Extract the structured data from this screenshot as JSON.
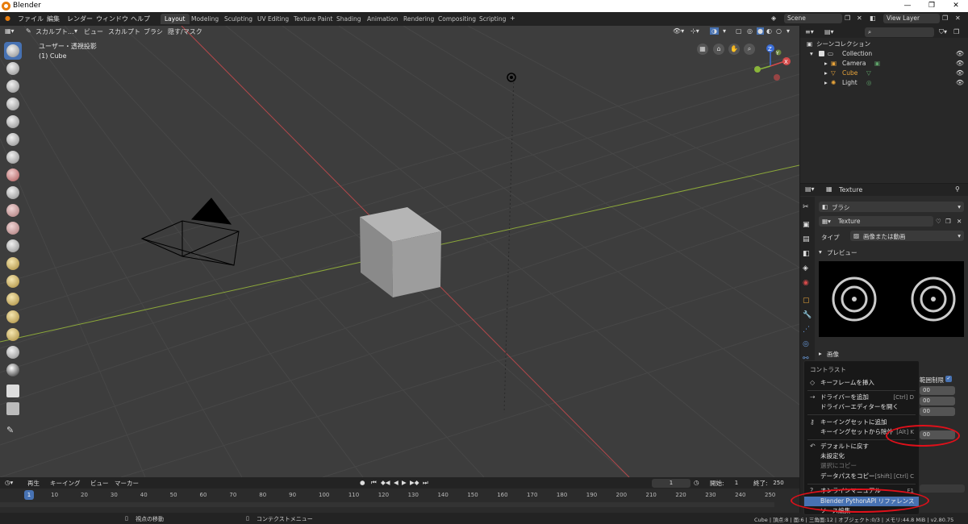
{
  "window": {
    "title": "Blender"
  },
  "menubar": {
    "items": [
      "ファイル",
      "編集",
      "レンダー",
      "ウィンドウ",
      "ヘルプ"
    ],
    "tabs": [
      "Layout",
      "Modeling",
      "Sculpting",
      "UV Editing",
      "Texture Paint",
      "Shading",
      "Animation",
      "Rendering",
      "Compositing",
      "Scripting"
    ],
    "active_tab": "Layout",
    "scene": "Scene",
    "view_layer": "View Layer"
  },
  "viewport": {
    "mode": "スカルプト...",
    "menus": [
      "ビュー",
      "スカルプト",
      "ブラシ",
      "隠す/マスク"
    ],
    "view_name": "ユーザー・透視投影",
    "object_name": "(1) Cube",
    "axis_labels": {
      "x": "X",
      "y": "Y",
      "z": "Z"
    }
  },
  "timeline": {
    "menus": [
      "再生",
      "キーイング",
      "ビュー",
      "マーカー"
    ],
    "current_frame": "1",
    "start_label": "開始:",
    "start": "1",
    "end_label": "終了:",
    "end": "250",
    "ticks": [
      "1",
      "10",
      "20",
      "30",
      "40",
      "50",
      "60",
      "70",
      "80",
      "90",
      "100",
      "110",
      "120",
      "130",
      "140",
      "150",
      "160",
      "170",
      "180",
      "190",
      "200",
      "210",
      "220",
      "230",
      "240",
      "250"
    ]
  },
  "statusbar": {
    "left": "視点の移動",
    "middle": "コンテクストメニュー",
    "right": "Cube | 頂点:8 | 面:6 | 三角面:12 | オブジェクト:0/3 | メモリ:44.8 MiB | v2.80.75"
  },
  "outliner": {
    "root": "シーンコレクション",
    "items": [
      {
        "name": "Collection",
        "color": "#dddddd"
      },
      {
        "name": "Camera",
        "color": "#dddddd"
      },
      {
        "name": "Cube",
        "color": "#e8a43a"
      },
      {
        "name": "Light",
        "color": "#dddddd"
      }
    ]
  },
  "properties": {
    "header": "Texture",
    "brush": "ブラシ",
    "texture_name": "Texture",
    "type_label": "タイプ",
    "type_value": "画像または動画",
    "preview_label": "プレビュー",
    "image_label": "画像",
    "clamp_label": "範囲制限",
    "field_value": "00"
  },
  "context_menu": {
    "title": "コントラスト",
    "items": [
      {
        "label": "キーフレームを挿入",
        "shortcut": "",
        "icon": "keyframe-icon"
      },
      {
        "label": "ドライバーを追加",
        "shortcut": "[Ctrl] D",
        "icon": "driver-icon"
      },
      {
        "label": "ドライバーエディターを開く",
        "shortcut": "",
        "icon": ""
      },
      {
        "label": "キーイングセットに追加",
        "shortcut": "",
        "icon": "keyingset-icon"
      },
      {
        "label": "キーイングセットから除外",
        "shortcut": "[Alt] K",
        "icon": ""
      },
      {
        "label": "デフォルトに戻す",
        "shortcut": "",
        "icon": "reset-icon"
      },
      {
        "label": "未設定化",
        "shortcut": "",
        "icon": ""
      },
      {
        "label": "選択にコピー",
        "shortcut": "",
        "icon": ""
      },
      {
        "label": "データパスをコピー",
        "shortcut": "[Shift] [Ctrl] C",
        "icon": ""
      },
      {
        "label": "オンラインマニュアル",
        "shortcut": "F1",
        "icon": "help-icon"
      },
      {
        "label": "Blender PythonAPI リファレンス",
        "shortcut": "",
        "icon": ""
      },
      {
        "label": "ソース編集",
        "shortcut": "",
        "icon": ""
      }
    ]
  },
  "colors": {
    "accent": "#4772b3",
    "annotation": "#e0101a",
    "x_axis": "#b4484b",
    "y_axis": "#8ca83a"
  }
}
